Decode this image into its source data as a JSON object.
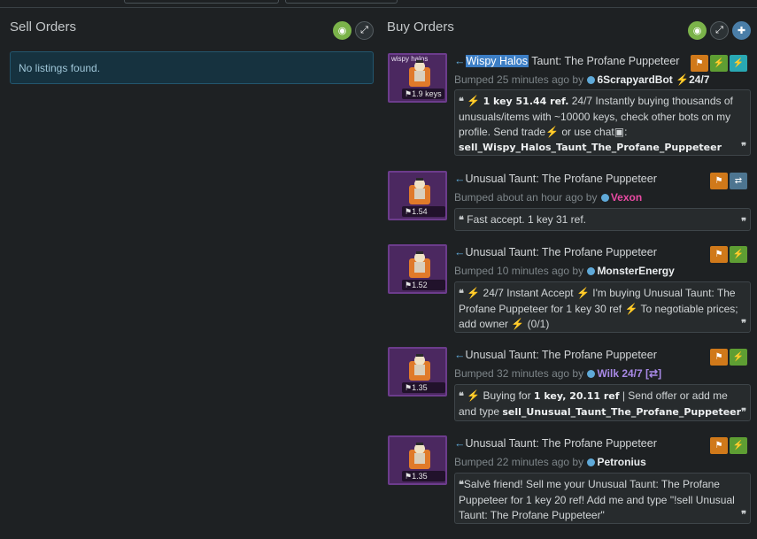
{
  "sell": {
    "title": "Sell Orders",
    "no_listings": "No listings found."
  },
  "buy": {
    "title": "Buy Orders"
  },
  "listings": [
    {
      "effect": "wispy halos",
      "price": "1.9 keys",
      "title_highlight": "Wispy Halos",
      "title_rest": " Taunt: The Profane Puppeteer",
      "bumped": "Bumped 25 minutes ago by",
      "user": "6ScrapyardBot",
      "user_suffix": "24/7",
      "comment_a": " ",
      "comment_price": "1 key 51.44 ref.",
      "comment_b": " 24/7 Instantly buying thousands of unusuals/items with ~10000 keys, check other bots on my profile. Send  trade",
      "comment_c": " or  use  chat",
      "comment_d": ":",
      "comment_cmd": "sell_Wispy_Halos_Taunt_The_Profane_Puppeteer"
    },
    {
      "price": "1.54 keys",
      "title": "Unusual Taunt: The Profane Puppeteer",
      "bumped": "Bumped about an hour ago by",
      "user": "Vexon",
      "comment": "Fast accept. 1 key 31 ref."
    },
    {
      "price": "1.52 keys",
      "title": "Unusual Taunt: The Profane Puppeteer",
      "bumped": "Bumped 10 minutes ago by",
      "user": "MonsterEnergy",
      "comment_a": " 24/7 Instant Accept",
      "comment_b": " I'm buying Unusual Taunt: The Profane Puppeteer for 1 key 30 ref",
      "comment_c": " To negotiable prices; add owner",
      "comment_d": " (0/1)"
    },
    {
      "price": "1.35 keys",
      "title": "Unusual Taunt: The Profane Puppeteer",
      "bumped": "Bumped 32 minutes ago by",
      "user": "Wilk 24/7 [⇄]",
      "comment_a": "  Buying for ",
      "comment_price": "1 key, 20.11 ref",
      "comment_b": " | Send offer or add me and type ",
      "comment_cmd": "sell_Unusual_Taunt_The_Profane_Puppeteer"
    },
    {
      "price": "1.35 keys",
      "title": "Unusual Taunt: The Profane Puppeteer",
      "bumped": "Bumped 22 minutes ago by",
      "user": "Petronius",
      "comment": "Salvē friend! Sell me your Unusual Taunt: The Profane Puppeteer for 1 key 20 ref! Add me and type \"!sell Unusual Taunt: The Profane Puppeteer\""
    }
  ],
  "icons": {
    "eye": "eye-icon",
    "expand": "expand-icon",
    "plus": "plus-icon",
    "flag": "flag-icon",
    "bolt": "lightning-icon",
    "swap": "swap-icon",
    "quote": "quote-icon",
    "tag": "tag-icon"
  },
  "colors": {
    "background": "#1e2123",
    "highlight": "#3d7fc6",
    "unusual_border": "#6c3c8c",
    "flag_orange": "#d0791a",
    "bolt_green": "#5e9e33",
    "bolt_teal": "#29a8b3",
    "swap_steel": "#4d7590",
    "user_pink": "#e94aa3",
    "user_purple": "#a889e6"
  }
}
